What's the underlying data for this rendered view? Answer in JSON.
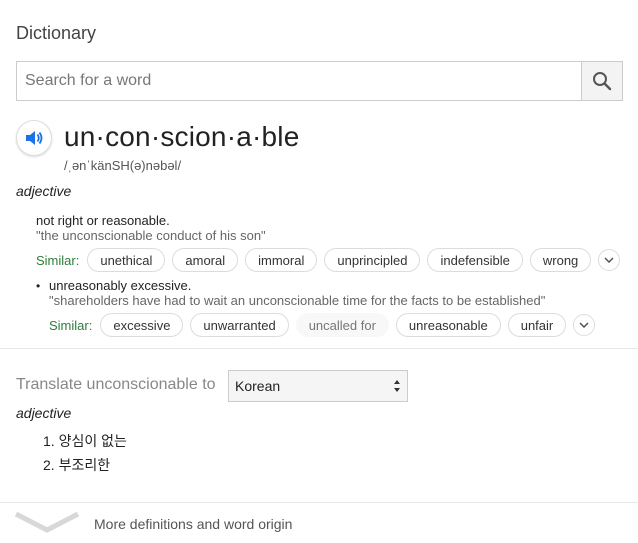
{
  "header": {
    "title": "Dictionary"
  },
  "search": {
    "placeholder": "Search for a word",
    "value": "",
    "button_icon": "search-icon"
  },
  "entry": {
    "speaker_icon": "speaker-icon",
    "headword": "un·con·scion·a·ble",
    "phonetic": "/ˌənˈkänSH(ə)nəbəl/",
    "part_of_speech": "adjective",
    "senses": [
      {
        "definition": "not right or reasonable.",
        "example": "\"the unconscionable conduct of his son\"",
        "similar_label": "Similar:",
        "similar": [
          "unethical",
          "amoral",
          "immoral",
          "unprincipled",
          "indefensible",
          "wrong"
        ]
      },
      {
        "bullet": "•",
        "definition": "unreasonably excessive.",
        "example": "\"shareholders have had to wait an unconscionable time for the facts to be established\"",
        "similar_label": "Similar:",
        "similar": [
          "excessive",
          "unwarranted",
          "uncalled for",
          "unreasonable",
          "unfair"
        ]
      }
    ]
  },
  "translate": {
    "label": "Translate unconscionable to",
    "language": "Korean",
    "part_of_speech": "adjective",
    "items": [
      "1. 양심이 없는",
      "2. 부조리한"
    ]
  },
  "footer": {
    "more_label": "More definitions and word origin"
  },
  "colors": {
    "similar_green": "#2f7d3c",
    "speaker_blue": "#1a73e8"
  }
}
